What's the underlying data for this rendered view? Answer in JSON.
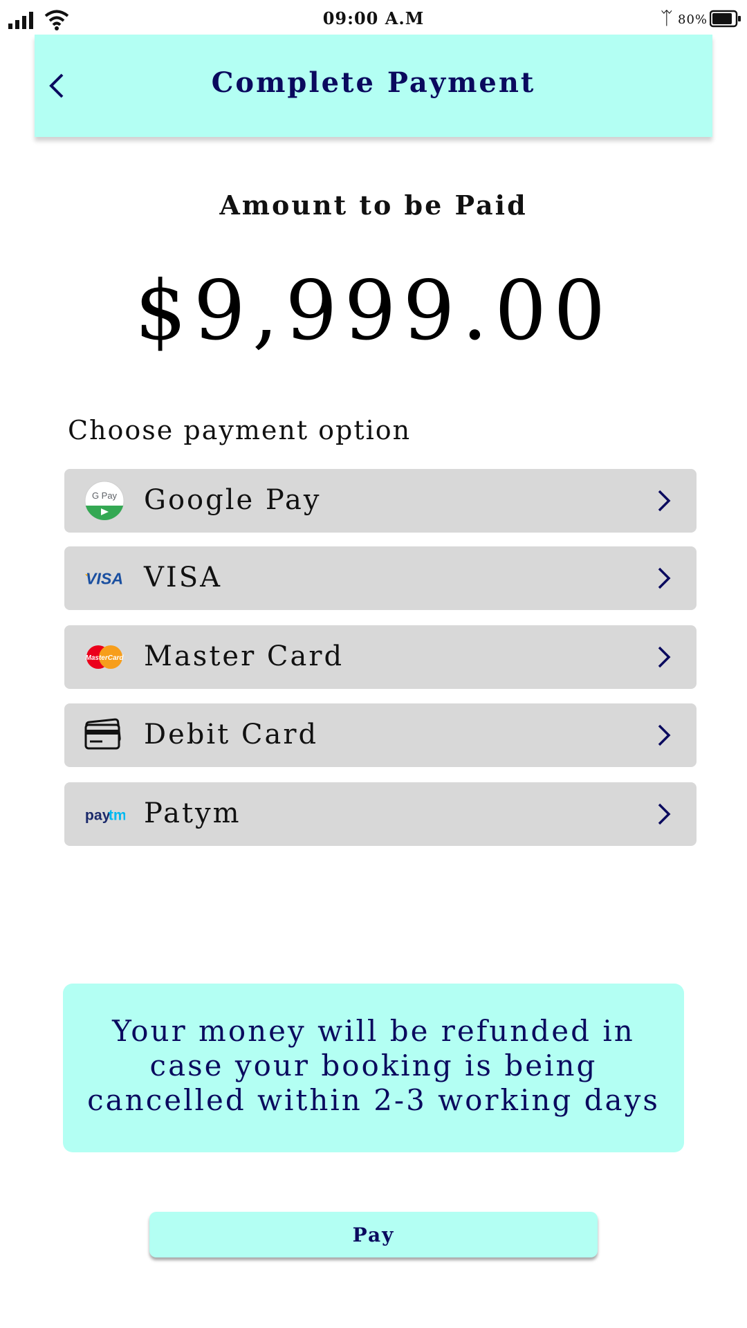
{
  "status_bar": {
    "time": "09:00 A.M",
    "battery": "80%"
  },
  "header": {
    "title": "Complete Payment"
  },
  "amount": {
    "label": "Amount to be Paid",
    "value": "$9,999.00"
  },
  "payment": {
    "heading": "Choose payment option",
    "options": [
      {
        "label": "Google Pay",
        "icon": "google-pay-icon"
      },
      {
        "label": "VISA",
        "icon": "visa-icon"
      },
      {
        "label": "Master Card",
        "icon": "mastercard-icon"
      },
      {
        "label": "Debit Card",
        "icon": "debit-card-icon"
      },
      {
        "label": "Patym",
        "icon": "paytm-icon"
      }
    ]
  },
  "notice": {
    "text": "Your money will be refunded in case your booking is being cancelled within 2-3 working days"
  },
  "pay_button": {
    "label": "Pay"
  },
  "icon_text": {
    "gpay": "G Pay",
    "visa": "VISA",
    "mastercard": "MasterCard",
    "paytm_pay": "pay",
    "paytm_tm": "tm"
  },
  "colors": {
    "accent": "#b3fff3",
    "navy": "#0a0a5e",
    "option_bg": "#d8d8d8"
  }
}
